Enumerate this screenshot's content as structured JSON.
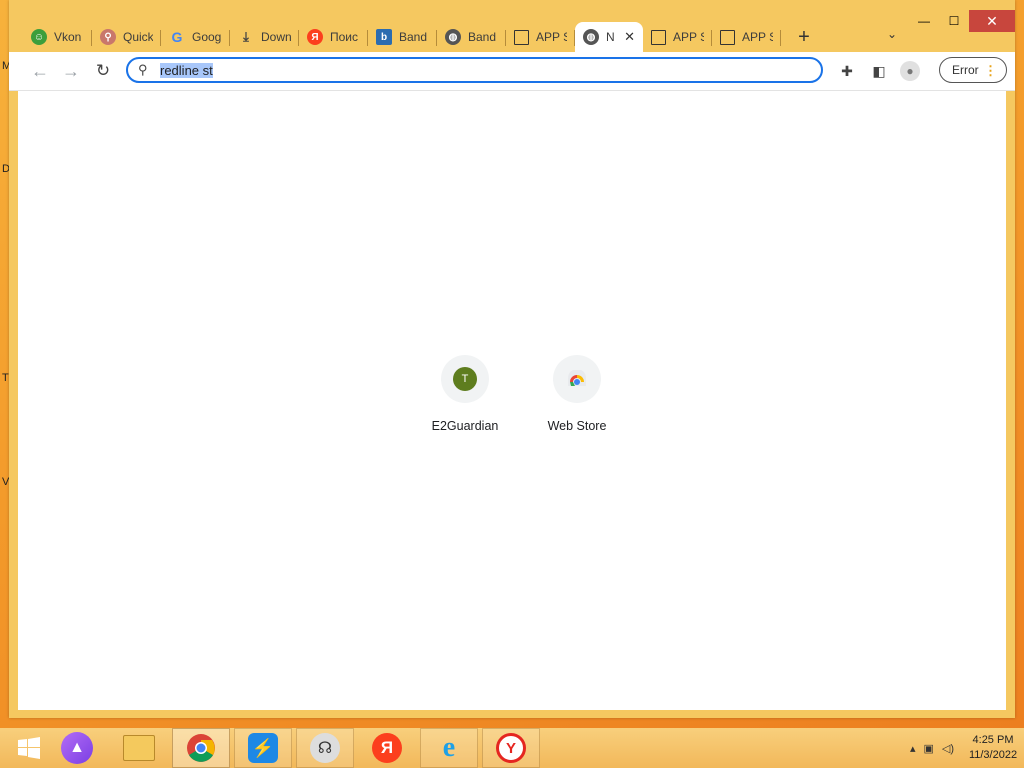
{
  "desktop": {
    "edge_letters": [
      "M",
      "D",
      "T",
      "V"
    ]
  },
  "window": {
    "controls": {
      "minimize": "—",
      "maximize": "☐",
      "close": "✕"
    },
    "tab_search_icon": "chevron-down-icon"
  },
  "tabs": [
    {
      "title": "Vkon",
      "icon": "vk-icon",
      "active": false
    },
    {
      "title": "Quick",
      "icon": "search-icon",
      "active": false
    },
    {
      "title": "Goog",
      "icon": "google-icon",
      "active": false
    },
    {
      "title": "Down",
      "icon": "download-icon",
      "active": false
    },
    {
      "title": "Поис",
      "icon": "yandex-icon",
      "active": false
    },
    {
      "title": "Band",
      "icon": "bandicam-icon",
      "active": false
    },
    {
      "title": "Band",
      "icon": "globe-icon",
      "active": false
    },
    {
      "title": "APP S",
      "icon": "table-icon",
      "active": false
    },
    {
      "title": "N",
      "icon": "globe-icon",
      "active": true
    },
    {
      "title": "APP S",
      "icon": "table-icon",
      "active": false
    },
    {
      "title": "APP S",
      "icon": "table-icon",
      "active": false
    }
  ],
  "toolbar": {
    "omnibox_value": "redline st",
    "error_label": "Error"
  },
  "shortcuts": [
    {
      "label": "E2Guardian",
      "letter": "T",
      "icon": "letter-avatar"
    },
    {
      "label": "Web Store",
      "icon": "chrome-web-store-icon"
    }
  ],
  "taskbar": {
    "apps": [
      "windows-start-icon",
      "alice-icon",
      "file-explorer-icon",
      "chrome-icon",
      "transfer-app-icon",
      "headset-app-icon",
      "yandex-icon",
      "internet-explorer-icon",
      "yandex-browser-icon"
    ],
    "time": "4:25 PM",
    "date": "11/3/2022"
  },
  "colors": {
    "accent": "#1a73e8",
    "frame": "#f5c860",
    "close": "#c8463d"
  }
}
